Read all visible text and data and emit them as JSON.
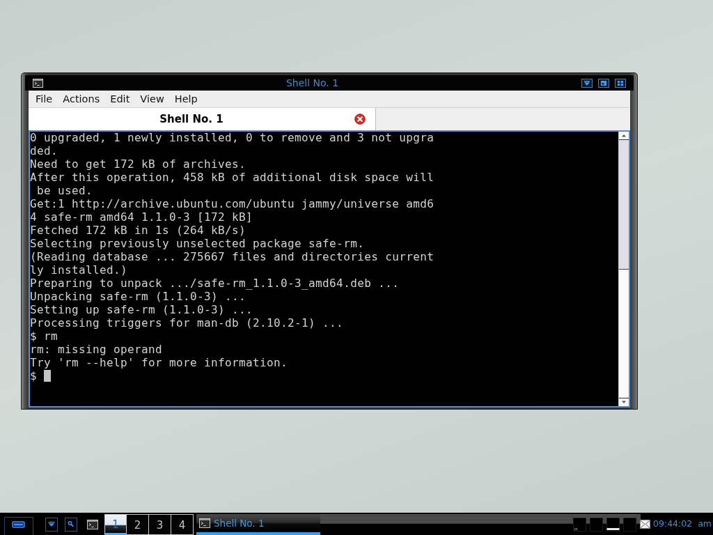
{
  "window": {
    "title": "Shell No. 1",
    "menu": [
      "File",
      "Actions",
      "Edit",
      "View",
      "Help"
    ],
    "tabs": [
      {
        "label": "Shell No. 1",
        "selected": true
      }
    ],
    "terminal": {
      "lines": [
        "0 upgraded, 1 newly installed, 0 to remove and 3 not upgra",
        "ded.",
        "Need to get 172 kB of archives.",
        "After this operation, 458 kB of additional disk space will",
        " be used.",
        "Get:1 http://archive.ubuntu.com/ubuntu jammy/universe amd6",
        "4 safe-rm amd64 1.1.0-3 [172 kB]",
        "Fetched 172 kB in 1s (264 kB/s)",
        "Selecting previously unselected package safe-rm.",
        "(Reading database ... 275667 files and directories current",
        "ly installed.)",
        "Preparing to unpack .../safe-rm_1.1.0-3_amd64.deb ...",
        "Unpacking safe-rm (1.1.0-3) ...",
        "Setting up safe-rm (1.1.0-3) ...",
        "Processing triggers for man-db (2.10.2-1) ...",
        "$ rm",
        "rm: missing operand",
        "Try 'rm --help' for more information.",
        "$"
      ],
      "cursor_visible": true
    }
  },
  "taskbar": {
    "workspaces": [
      {
        "label": "1",
        "selected": true
      },
      {
        "label": "2",
        "selected": false
      },
      {
        "label": "3",
        "selected": false
      },
      {
        "label": "4",
        "selected": false
      }
    ],
    "tasks": [
      {
        "label": "Shell No. 1",
        "selected": true
      }
    ],
    "clock": {
      "time": "09:44:02",
      "period": "am"
    }
  }
}
